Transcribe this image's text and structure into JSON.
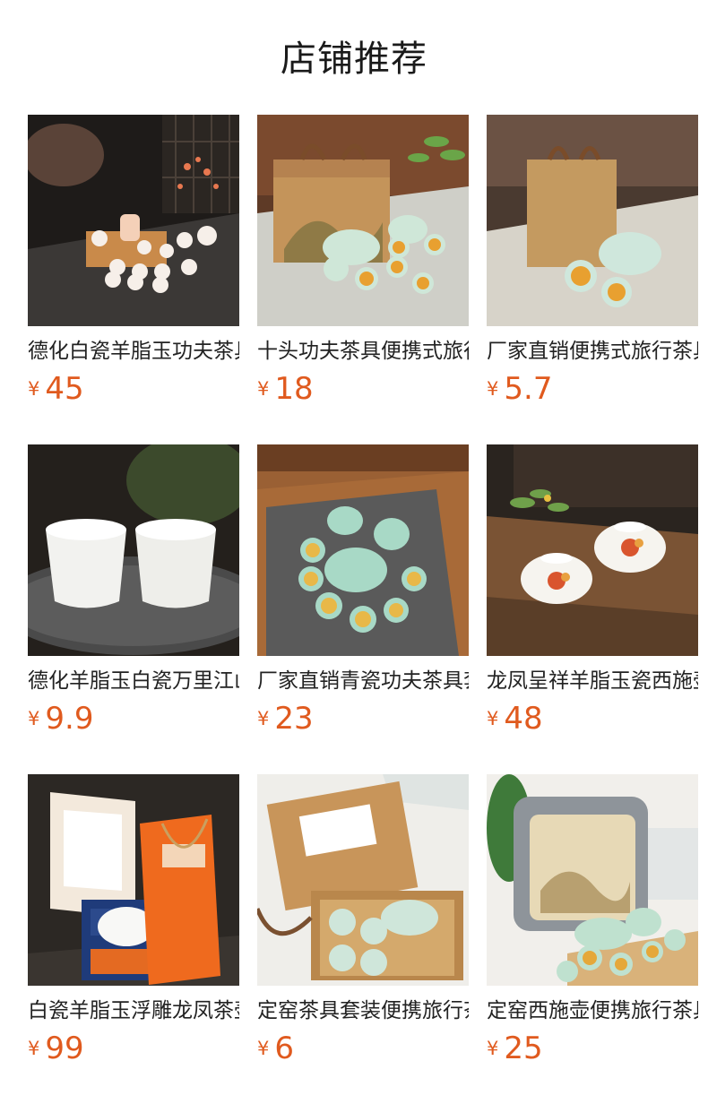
{
  "page": {
    "title": "店铺推荐"
  },
  "currency_symbol": "¥",
  "colors": {
    "price": "#e05a1e"
  },
  "products": [
    {
      "name": "德化白瓷羊脂玉功夫茶具",
      "price": "45"
    },
    {
      "name": "十头功夫茶具便携式旅行",
      "price": "18"
    },
    {
      "name": "厂家直销便携式旅行茶具",
      "price": "5.7"
    },
    {
      "name": "德化羊脂玉白瓷万里江山",
      "price": "9.9"
    },
    {
      "name": "厂家直销青瓷功夫茶具套",
      "price": "23"
    },
    {
      "name": "龙凤呈祥羊脂玉瓷西施壶",
      "price": "48"
    },
    {
      "name": "白瓷羊脂玉浮雕龙凤茶壶",
      "price": "99"
    },
    {
      "name": "定窑茶具套装便携旅行茶",
      "price": "6"
    },
    {
      "name": "定窑西施壶便携旅行茶具",
      "price": "25"
    }
  ]
}
